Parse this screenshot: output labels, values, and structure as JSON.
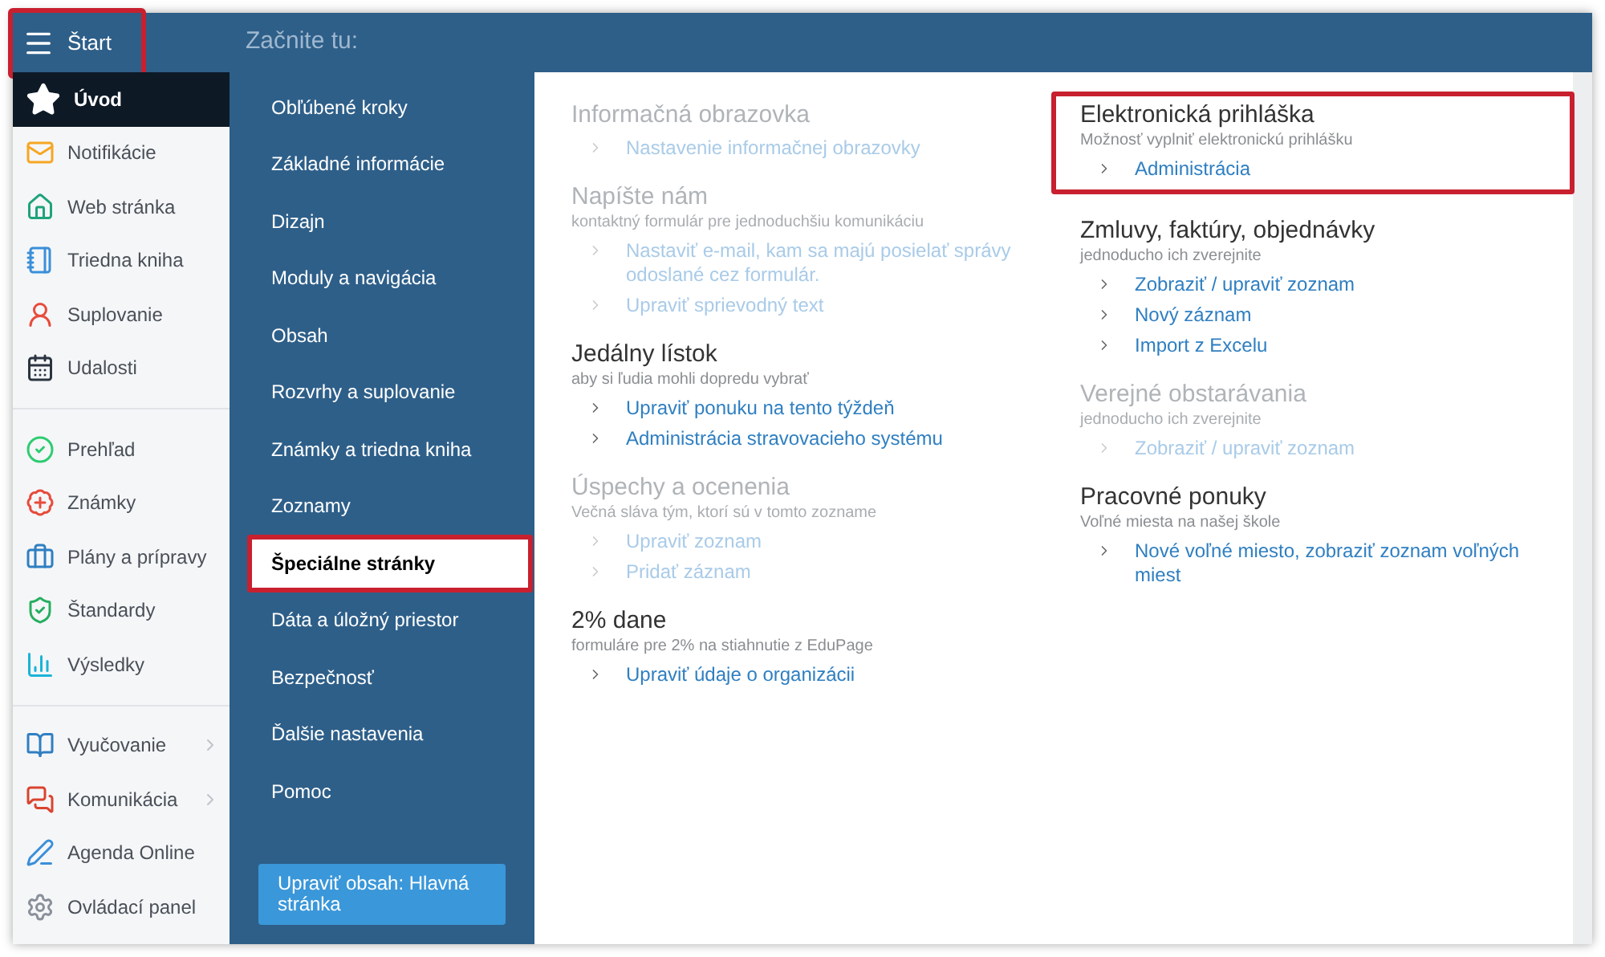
{
  "header": {
    "start_button": {
      "label": "Štart",
      "highlighted": true
    },
    "title": "Začnite tu:"
  },
  "sidebar": {
    "groups": [
      {
        "items": [
          {
            "label": "Úvod",
            "selected": true,
            "has_submenu": false
          },
          {
            "label": "Notifikácie",
            "selected": false,
            "has_submenu": false
          },
          {
            "label": "Web stránka",
            "selected": false,
            "has_submenu": false
          },
          {
            "label": "Triedna kniha",
            "selected": false,
            "has_submenu": false
          },
          {
            "label": "Suplovanie",
            "selected": false,
            "has_submenu": false
          },
          {
            "label": "Udalosti",
            "selected": false,
            "has_submenu": false
          }
        ]
      },
      {
        "items": [
          {
            "label": "Prehľad",
            "selected": false,
            "has_submenu": false
          },
          {
            "label": "Známky",
            "selected": false,
            "has_submenu": false
          },
          {
            "label": "Plány a prípravy",
            "selected": false,
            "has_submenu": false
          },
          {
            "label": "Štandardy",
            "selected": false,
            "has_submenu": false
          },
          {
            "label": "Výsledky",
            "selected": false,
            "has_submenu": false
          }
        ]
      },
      {
        "items": [
          {
            "label": "Vyučovanie",
            "selected": false,
            "has_submenu": true
          },
          {
            "label": "Komunikácia",
            "selected": false,
            "has_submenu": true
          },
          {
            "label": "Agenda Online",
            "selected": false,
            "has_submenu": false
          },
          {
            "label": "Ovládací panel",
            "selected": false,
            "has_submenu": false
          }
        ]
      }
    ]
  },
  "menu": {
    "items": [
      {
        "label": "Obľúbené kroky",
        "selected": false
      },
      {
        "label": "Základné informácie",
        "selected": false
      },
      {
        "label": "Dizajn",
        "selected": false
      },
      {
        "label": "Moduly a navigácia",
        "selected": false
      },
      {
        "label": "Obsah",
        "selected": false
      },
      {
        "label": "Rozvrhy a suplovanie",
        "selected": false
      },
      {
        "label": "Známky a triedna kniha",
        "selected": false
      },
      {
        "label": "Zoznamy",
        "selected": false
      },
      {
        "label": "Špeciálne stránky",
        "selected": true
      },
      {
        "label": "Dáta a úložný priestor",
        "selected": false
      },
      {
        "label": "Bezpečnosť",
        "selected": false
      },
      {
        "label": "Ďalšie nastavenia",
        "selected": false
      },
      {
        "label": "Pomoc",
        "selected": false
      }
    ],
    "edit_button": "Upraviť obsah: Hlavná stránka"
  },
  "content": {
    "columns": [
      {
        "sections": [
          {
            "title": "Informačná obrazovka",
            "disabled": true,
            "links": [
              "Nastavenie informačnej obrazovky"
            ]
          },
          {
            "title": "Napíšte nám",
            "subtitle": "kontaktný formulár pre jednoduchšiu komunikáciu",
            "disabled": true,
            "links": [
              "Nastaviť e-mail, kam sa majú posielať správy odoslané cez formulár.",
              "Upraviť sprievodný text"
            ]
          },
          {
            "title": "Jedálny lístok",
            "subtitle": "aby si ľudia mohli dopredu vybrať",
            "disabled": false,
            "links": [
              "Upraviť ponuku na tento týždeň",
              "Administrácia stravovacieho systému"
            ]
          },
          {
            "title": "Úspechy a ocenenia",
            "subtitle": "Večná sláva tým, ktorí sú v tomto zozname",
            "disabled": true,
            "links": [
              "Upraviť zoznam",
              "Pridať záznam"
            ]
          },
          {
            "title": "2% dane",
            "subtitle": "formuláre pre 2% na stiahnutie z EduPage",
            "disabled": false,
            "links": [
              "Upraviť údaje o organizácii"
            ]
          }
        ]
      },
      {
        "sections": [
          {
            "title": "Elektronická prihláška",
            "subtitle": "Možnosť vyplniť elektronickú prihlášku",
            "disabled": false,
            "highlighted": true,
            "links": [
              "Administrácia"
            ]
          },
          {
            "title": "Zmluvy, faktúry, objednávky",
            "subtitle": "jednoducho ich zverejnite",
            "disabled": false,
            "links": [
              "Zobraziť / upraviť zoznam",
              "Nový záznam",
              "Import z Excelu"
            ]
          },
          {
            "title": "Verejné obstarávania",
            "subtitle": "jednoducho ich zverejnite",
            "disabled": true,
            "links": [
              "Zobraziť / upraviť zoznam"
            ]
          },
          {
            "title": "Pracovné ponuky",
            "subtitle": "Voľné miesta na našej škole",
            "disabled": false,
            "links": [
              "Nové voľné miesto, zobraziť zoznam voľných miest"
            ]
          }
        ]
      }
    ]
  }
}
